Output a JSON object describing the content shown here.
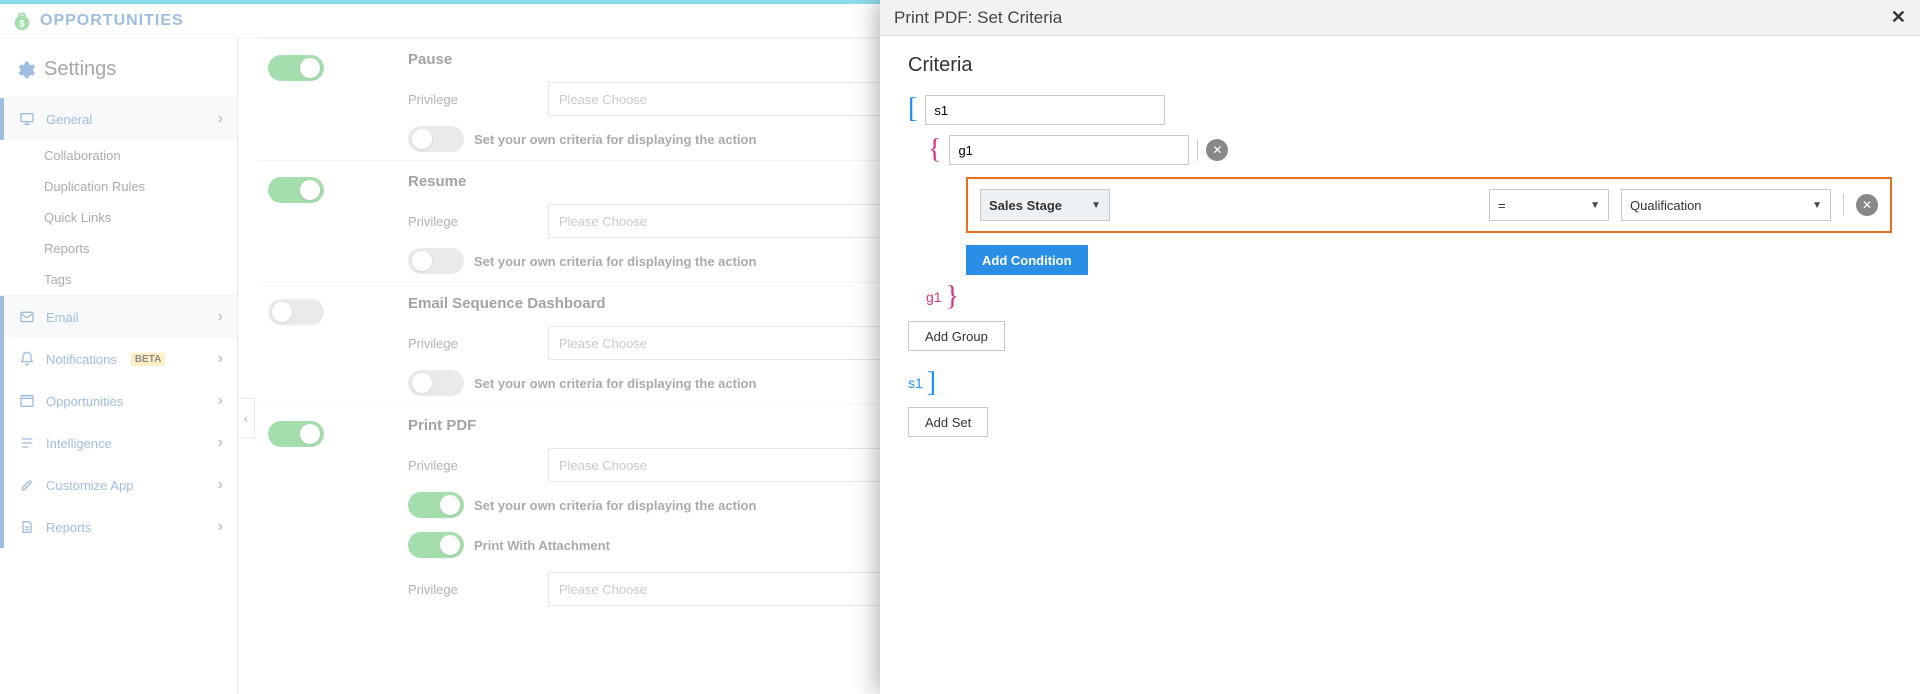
{
  "header": {
    "title": "OPPORTUNITIES"
  },
  "sidebar": {
    "title": "Settings",
    "general": "General",
    "subs": [
      "Collaboration",
      "Duplication Rules",
      "Quick Links",
      "Reports",
      "Tags"
    ],
    "items": [
      {
        "label": "Email"
      },
      {
        "label": "Notifications",
        "badge": "BETA"
      },
      {
        "label": "Opportunities"
      },
      {
        "label": "Intelligence"
      },
      {
        "label": "Customize App"
      },
      {
        "label": "Reports"
      }
    ]
  },
  "content": {
    "privilege_label": "Privilege",
    "privilege_placeholder": "Please Choose",
    "criteria_text": "Set your own criteria for displaying the action",
    "rows": [
      {
        "title": "Pause",
        "toggle": "on",
        "criteria_toggle": "off"
      },
      {
        "title": "Resume",
        "toggle": "on",
        "criteria_toggle": "off"
      },
      {
        "title": "Email Sequence Dashboard",
        "toggle": "off",
        "criteria_toggle": "off"
      },
      {
        "title": "Print PDF",
        "toggle": "on",
        "criteria_toggle": "on",
        "extra_toggle_label": "Print With Attachment",
        "extra_toggle": "on"
      }
    ]
  },
  "modal": {
    "title": "Print PDF: Set Criteria",
    "section": "Criteria",
    "set_name": "s1",
    "group_name": "g1",
    "condition": {
      "field": "Sales Stage",
      "operator": "=",
      "value": "Qualification"
    },
    "add_condition": "Add Condition",
    "add_group": "Add Group",
    "add_set": "Add Set"
  }
}
